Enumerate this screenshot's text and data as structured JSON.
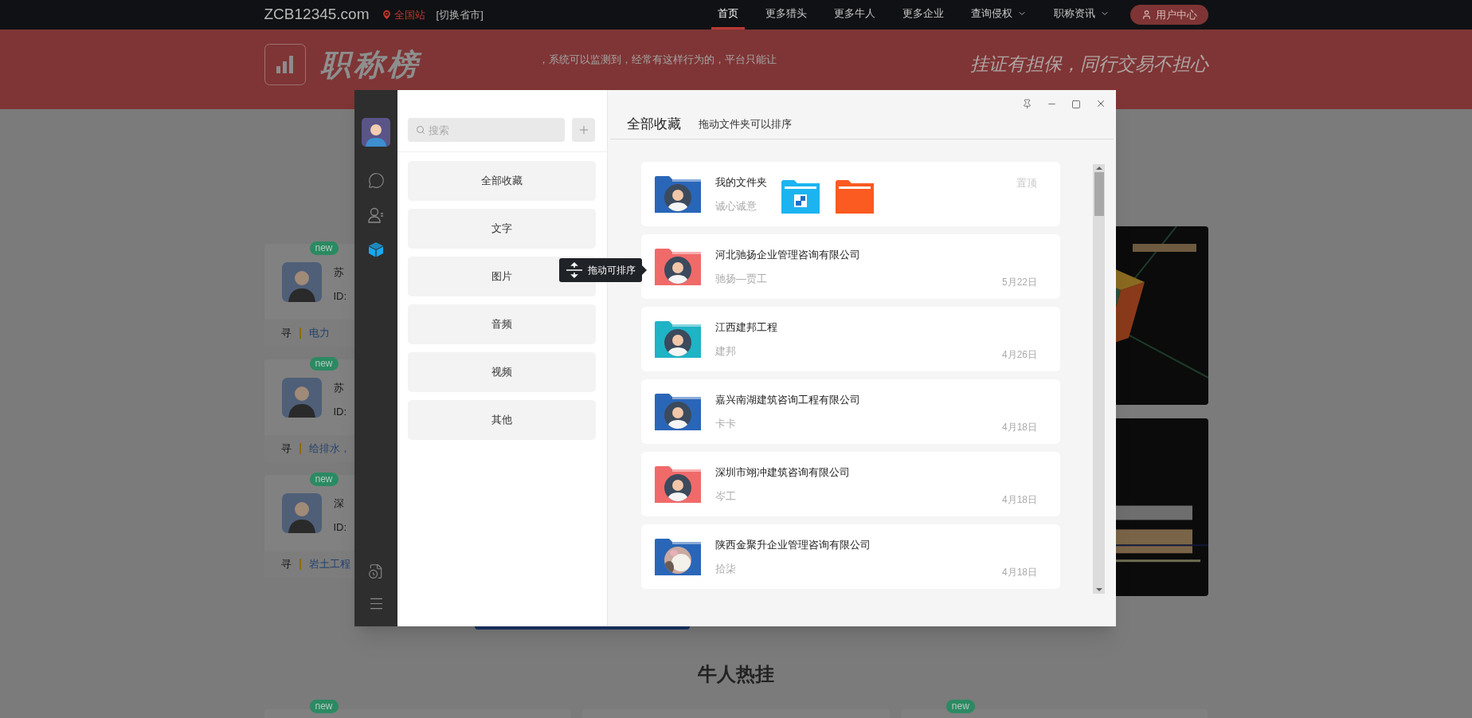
{
  "top_nav": {
    "site": "ZCB12345.com",
    "location": "全国站",
    "switch": "[切换省市]",
    "items": [
      {
        "label": "首页",
        "selected": true,
        "dropdown": false
      },
      {
        "label": "更多猎头",
        "selected": false,
        "dropdown": false
      },
      {
        "label": "更多牛人",
        "selected": false,
        "dropdown": false
      },
      {
        "label": "更多企业",
        "selected": false,
        "dropdown": false
      },
      {
        "label": "查询侵权",
        "selected": false,
        "dropdown": true
      },
      {
        "label": "职称资讯",
        "selected": false,
        "dropdown": true
      }
    ],
    "user_button": "用户中心"
  },
  "banner": {
    "logo_text": "职称榜",
    "ticker": "，系统可以监测到，经常有这样行为的，平台只能让",
    "slogan": "挂证有担保，同行交易不担心"
  },
  "background_cards": [
    {
      "badge": "new",
      "name": "苏",
      "id": "ID:",
      "tag": "寻",
      "field": "电力"
    },
    {
      "badge": "new",
      "name": "苏",
      "id": "ID:",
      "tag": "寻",
      "field": "给排水，"
    },
    {
      "badge": "new",
      "name": "深",
      "id": "ID:",
      "tag": "寻",
      "field": "岩土工程"
    }
  ],
  "section_title": "牛人热挂",
  "bottom_cards": [
    {
      "kind": "badged",
      "badge": "new"
    },
    {
      "kind": "plain"
    },
    {
      "kind": "badged",
      "badge": "new"
    }
  ],
  "window": {
    "rail": [
      {
        "kind": "chat",
        "selected": false
      },
      {
        "kind": "contacts",
        "selected": false
      },
      {
        "kind": "favorites",
        "selected": true
      }
    ],
    "search": {
      "placeholder": "搜索"
    },
    "categories": [
      "全部收藏",
      "文字",
      "图片",
      "音频",
      "视频",
      "其他"
    ],
    "tooltip": "拖动可排序",
    "header": {
      "title": "全部收藏",
      "hint": "拖动文件夹可以排序"
    },
    "folders": [
      {
        "kind": "pinned",
        "title": "我的文件夹",
        "subtitle": "诚心诚意",
        "action": "置顶",
        "color": "#2a66b8",
        "avatar": {
          "kind": "figure"
        }
      },
      {
        "kind": "dated",
        "title": "河北驰扬企业管理咨询有限公司",
        "subtitle": "驰扬—贾工",
        "date": "5月22日",
        "color": "#f06a6a",
        "avatar": {
          "kind": "figure"
        }
      },
      {
        "kind": "dated",
        "title": "江西建邦工程",
        "subtitle": "建邦",
        "date": "4月26日",
        "color": "#1fb3c6",
        "avatar": {
          "kind": "figure"
        }
      },
      {
        "kind": "dated",
        "title": "嘉兴南湖建筑咨询工程有限公司",
        "subtitle": "卡卡",
        "date": "4月18日",
        "color": "#2a66b8",
        "avatar": {
          "kind": "figure"
        }
      },
      {
        "kind": "dated",
        "title": "深圳市翊冲建筑咨询有限公司",
        "subtitle": "岑工",
        "date": "4月18日",
        "color": "#f06a6a",
        "avatar": {
          "kind": "figure"
        }
      },
      {
        "kind": "dated",
        "title": "陕西金聚升企业管理咨询有限公司",
        "subtitle": "拾柒",
        "date": "4月18日",
        "color": "#2a66b8"
      }
    ]
  }
}
